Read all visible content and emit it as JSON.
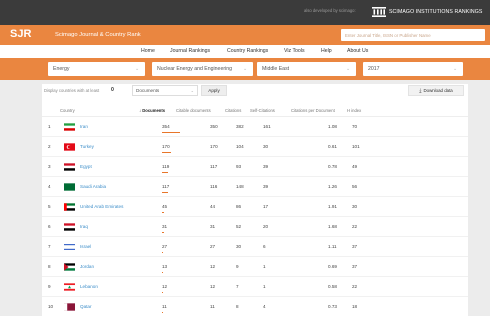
{
  "top": {
    "also_text": "also developed by scimago:",
    "institutions_label": "SCIMAGO INSTITUTIONS RANKINGS"
  },
  "header": {
    "logo": "SJR",
    "subtitle": "Scimago Journal & Country Rank",
    "search_placeholder": "Enter Journal Title, ISSN or Publisher Name"
  },
  "nav": [
    {
      "label": "Home",
      "name": "nav-home"
    },
    {
      "label": "Journal Rankings",
      "name": "nav-journal-rankings"
    },
    {
      "label": "Country Rankings",
      "name": "nav-country-rankings"
    },
    {
      "label": "Viz Tools",
      "name": "nav-viz-tools"
    },
    {
      "label": "Help",
      "name": "nav-help"
    },
    {
      "label": "About Us",
      "name": "nav-about-us"
    }
  ],
  "filters": {
    "subject_area": "Energy",
    "category": "Nuclear Energy and Engineering",
    "region": "Middle East",
    "year": "2017"
  },
  "controls": {
    "display_label": "Display countries with at least",
    "min_value": "0",
    "metric": "Documents",
    "apply": "Apply",
    "download": "Download data"
  },
  "columns": [
    "Country",
    "Documents",
    "Citable documents",
    "Citations",
    "Self-Citations",
    "Citations per Document",
    "H index"
  ],
  "active_column_marker": "↓",
  "rows": [
    {
      "rank": "1",
      "country": "Iran",
      "documents": "354",
      "citable": "350",
      "citations": "382",
      "self": "161",
      "cpd": "1.08",
      "h": "70",
      "flag": [
        "#239f40",
        "#ffffff",
        "#da0000"
      ],
      "flag_type": "h3",
      "bar": 1.0
    },
    {
      "rank": "2",
      "country": "Turkey",
      "documents": "170",
      "citable": "170",
      "citations": "104",
      "self": "30",
      "cpd": "0.61",
      "h": "101",
      "flag": [
        "#e30a17"
      ],
      "flag_type": "solid-crescent",
      "bar": 0.48
    },
    {
      "rank": "3",
      "country": "Egypt",
      "documents": "119",
      "citable": "117",
      "citations": "93",
      "self": "39",
      "cpd": "0.78",
      "h": "49",
      "flag": [
        "#ce1126",
        "#ffffff",
        "#000000"
      ],
      "flag_type": "h3",
      "bar": 0.34
    },
    {
      "rank": "4",
      "country": "Saudi Arabia",
      "documents": "117",
      "citable": "116",
      "citations": "148",
      "self": "39",
      "cpd": "1.26",
      "h": "56",
      "flag": [
        "#006c35"
      ],
      "flag_type": "solid",
      "bar": 0.33
    },
    {
      "rank": "5",
      "country": "United Arab Emirates",
      "documents": "45",
      "citable": "44",
      "citations": "86",
      "self": "17",
      "cpd": "1.91",
      "h": "30",
      "flag": [
        "#00732f",
        "#ffffff",
        "#000000",
        "#ff0000"
      ],
      "flag_type": "uae",
      "bar": 0.13
    },
    {
      "rank": "6",
      "country": "Iraq",
      "documents": "31",
      "citable": "31",
      "citations": "52",
      "self": "20",
      "cpd": "1.68",
      "h": "22",
      "flag": [
        "#ce1126",
        "#ffffff",
        "#000000"
      ],
      "flag_type": "h3",
      "bar": 0.09
    },
    {
      "rank": "7",
      "country": "Israel",
      "documents": "27",
      "citable": "27",
      "citations": "30",
      "self": "6",
      "cpd": "1.11",
      "h": "37",
      "flag": [
        "#ffffff",
        "#0038b8"
      ],
      "flag_type": "israel",
      "bar": 0.08
    },
    {
      "rank": "8",
      "country": "Jordan",
      "documents": "13",
      "citable": "12",
      "citations": "9",
      "self": "1",
      "cpd": "0.69",
      "h": "37",
      "flag": [
        "#000000",
        "#ffffff",
        "#007a3d",
        "#ce1126"
      ],
      "flag_type": "tri-left",
      "bar": 0.04
    },
    {
      "rank": "9",
      "country": "Lebanon",
      "documents": "12",
      "citable": "12",
      "citations": "7",
      "self": "1",
      "cpd": "0.58",
      "h": "22",
      "flag": [
        "#ed1c24",
        "#ffffff",
        "#00a651"
      ],
      "flag_type": "lebanon",
      "bar": 0.035
    },
    {
      "rank": "10",
      "country": "Qatar",
      "documents": "11",
      "citable": "11",
      "citations": "8",
      "self": "4",
      "cpd": "0.73",
      "h": "18",
      "flag": [
        "#8a1538",
        "#ffffff"
      ],
      "flag_type": "qatar",
      "bar": 0.03
    }
  ]
}
